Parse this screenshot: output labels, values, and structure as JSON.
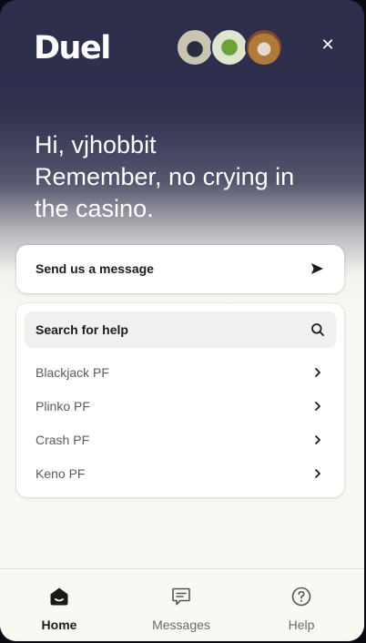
{
  "header": {
    "logo_text": "Duel",
    "close_label": "✕",
    "avatars": [
      "avatar-1",
      "avatar-2",
      "avatar-3"
    ]
  },
  "greeting": {
    "line1": "Hi, vjhobbit",
    "line2": "Remember, no crying in",
    "line3": "the casino."
  },
  "message_card": {
    "label": "Send us a message",
    "icon": "send-icon"
  },
  "help_card": {
    "search_label": "Search for help",
    "search_icon": "search-icon",
    "items": [
      {
        "label": "Blackjack PF"
      },
      {
        "label": "Plinko PF"
      },
      {
        "label": "Crash PF"
      },
      {
        "label": "Keno PF"
      }
    ]
  },
  "bottom_nav": {
    "items": [
      {
        "label": "Home",
        "icon": "home-icon",
        "active": true
      },
      {
        "label": "Messages",
        "icon": "messages-icon",
        "active": false
      },
      {
        "label": "Help",
        "icon": "help-icon",
        "active": false
      }
    ]
  },
  "colors": {
    "header_bg": "#2d2d4c",
    "body_bg": "#faf8f2",
    "card_bg": "#ffffff",
    "search_bg": "#f1f0ee",
    "text_dark": "#1c1c1c",
    "text_muted": "#5c5c5c"
  }
}
